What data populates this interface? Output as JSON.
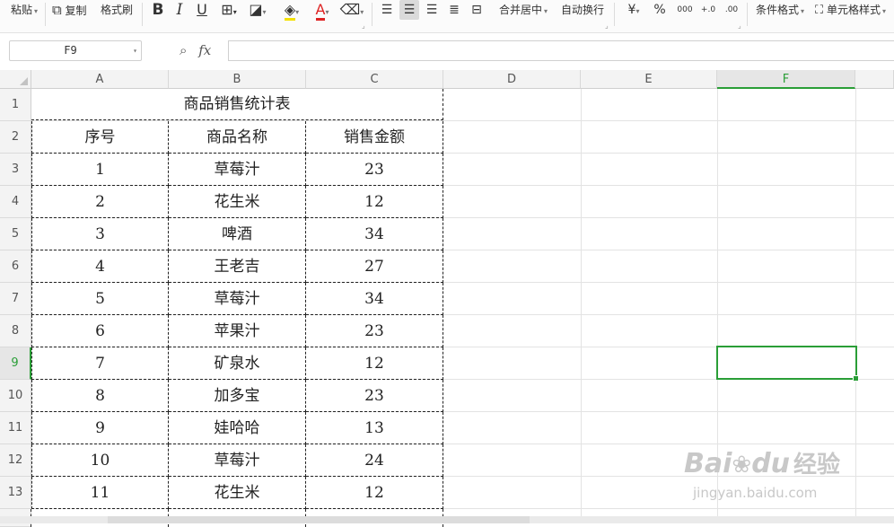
{
  "ribbon": {
    "paste": "粘贴",
    "copy": "复制",
    "format_painter": "格式刷",
    "bold": "B",
    "italic": "I",
    "underline": "U",
    "font_color": "A",
    "merge_center": "合并居中",
    "wrap_text": "自动换行",
    "currency": "¥",
    "percent": "%",
    "thousands": "000",
    "inc_decimal": "+.0",
    "dec_decimal": ".00",
    "conditional_format": "条件格式",
    "cell_style": "单元格样式"
  },
  "formula_bar": {
    "name_box": "F9",
    "fx": "fx",
    "content": ""
  },
  "columns": [
    "A",
    "B",
    "C",
    "D",
    "E",
    "F"
  ],
  "selected_column": "F",
  "rows": [
    "1",
    "2",
    "3",
    "4",
    "5",
    "6",
    "7",
    "8",
    "9",
    "10",
    "11",
    "12",
    "13"
  ],
  "selected_row": "9",
  "table": {
    "title": "商品销售统计表",
    "headers": [
      "序号",
      "商品名称",
      "销售金额"
    ],
    "data": [
      [
        "1",
        "草莓汁",
        "23"
      ],
      [
        "2",
        "花生米",
        "12"
      ],
      [
        "3",
        "啤酒",
        "34"
      ],
      [
        "4",
        "王老吉",
        "27"
      ],
      [
        "5",
        "草莓汁",
        "34"
      ],
      [
        "6",
        "苹果汁",
        "23"
      ],
      [
        "7",
        "矿泉水",
        "12"
      ],
      [
        "8",
        "加多宝",
        "23"
      ],
      [
        "9",
        "娃哈哈",
        "13"
      ],
      [
        "10",
        "草莓汁",
        "24"
      ],
      [
        "11",
        "花生米",
        "12"
      ]
    ]
  },
  "watermark": {
    "brand_left": "Bai",
    "brand_right": "du",
    "brand_cn": "经验",
    "url": "jingyan.baidu.com"
  },
  "colors": {
    "accent": "#2a9e37",
    "grid": "#e3e3e3"
  }
}
